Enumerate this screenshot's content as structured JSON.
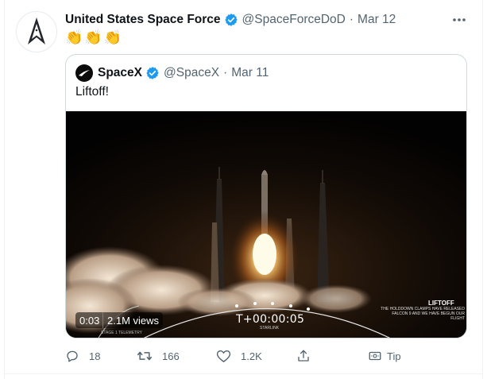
{
  "tweet": {
    "author": "United States Space Force",
    "handle": "@SpaceForceDoD",
    "separator": "·",
    "time": "Mar 12",
    "text": "👏👏👏",
    "more_icon": "more-horizontal-icon"
  },
  "quoted_tweet": {
    "author": "SpaceX",
    "handle": "@SpaceX",
    "separator": "·",
    "time": "Mar 11",
    "text": "Liftoff!",
    "video": {
      "elapsed": "0:03",
      "views": "2.1M views",
      "mission_clock": "T+00:00:05",
      "clock_sub": "STARLINK",
      "stage_label": "STAGE 1 TELEMETRY",
      "overlay_title": "LIFTOFF",
      "overlay_sub": "THE HOLDDOWN CLAMPS HAVE RELEASED FALCON 9 AND WE HAVE BEGUN OUR FLIGHT"
    }
  },
  "actions": {
    "reply_count": "18",
    "retweet_count": "166",
    "like_count": "1.2K",
    "share_icon": "share-icon",
    "tip_label": "Tip"
  },
  "colors": {
    "verified": "#1d9bf0",
    "muted_text": "#536471",
    "border": "#cfd9de"
  }
}
